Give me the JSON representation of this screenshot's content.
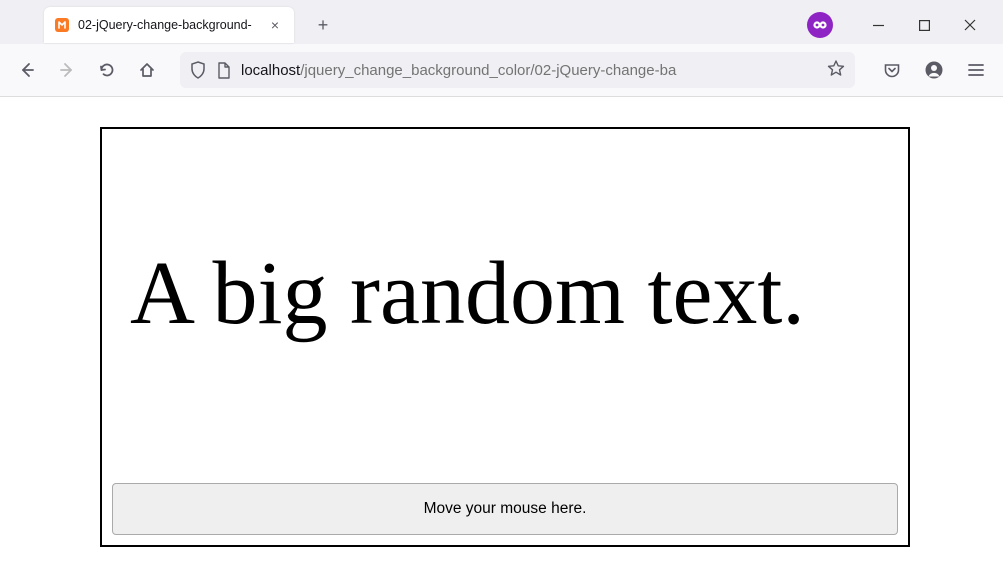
{
  "browser": {
    "tab": {
      "title": "02-jQuery-change-background-",
      "close_symbol": "×"
    },
    "new_tab_symbol": "+",
    "url": {
      "host": "localhost",
      "path": "/jquery_change_background_color/02-jQuery-change-ba"
    }
  },
  "page": {
    "heading": "A big random text.",
    "hover_label": "Move your mouse here."
  }
}
